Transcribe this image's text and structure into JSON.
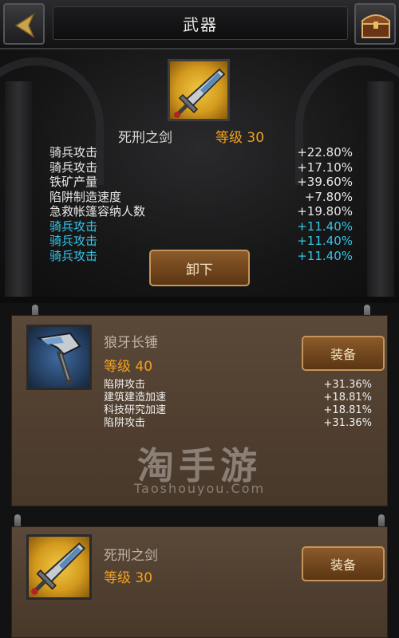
{
  "header": {
    "title": "武器"
  },
  "equipped": {
    "name": "死刑之剑",
    "level": "等级 30",
    "stats": [
      {
        "label": "骑兵攻击",
        "value": "+22.80%",
        "color": "white"
      },
      {
        "label": "骑兵攻击",
        "value": "+17.10%",
        "color": "white"
      },
      {
        "label": "铁矿产量",
        "value": "+39.60%",
        "color": "white"
      },
      {
        "label": "陷阱制造速度",
        "value": "+7.80%",
        "color": "white"
      },
      {
        "label": "急救帐篷容纳人数",
        "value": "+19.80%",
        "color": "white"
      },
      {
        "label": "骑兵攻击",
        "value": "+11.40%",
        "color": "cyan"
      },
      {
        "label": "骑兵攻击",
        "value": "+11.40%",
        "color": "cyan"
      },
      {
        "label": "骑兵攻击",
        "value": "+11.40%",
        "color": "cyan"
      }
    ],
    "unequip_label": "卸下"
  },
  "inventory": [
    {
      "name": "狼牙长锤",
      "level": "等级 40",
      "equip_label": "装备",
      "stats": [
        {
          "label": "陷阱攻击",
          "value": "+31.36%"
        },
        {
          "label": "建筑建造加速",
          "value": "+18.81%"
        },
        {
          "label": "科技研究加速",
          "value": "+18.81%"
        },
        {
          "label": "陷阱攻击",
          "value": "+31.36%"
        }
      ]
    },
    {
      "name": "死刑之剑",
      "level": "等级 30",
      "equip_label": "装备"
    }
  ],
  "watermark": {
    "cn": "淘手游",
    "en": "Taoshouyou.Com"
  },
  "colors": {
    "stat_white": "#e8e8e8",
    "stat_cyan": "#35c5e6",
    "level": "#f3a21c"
  }
}
